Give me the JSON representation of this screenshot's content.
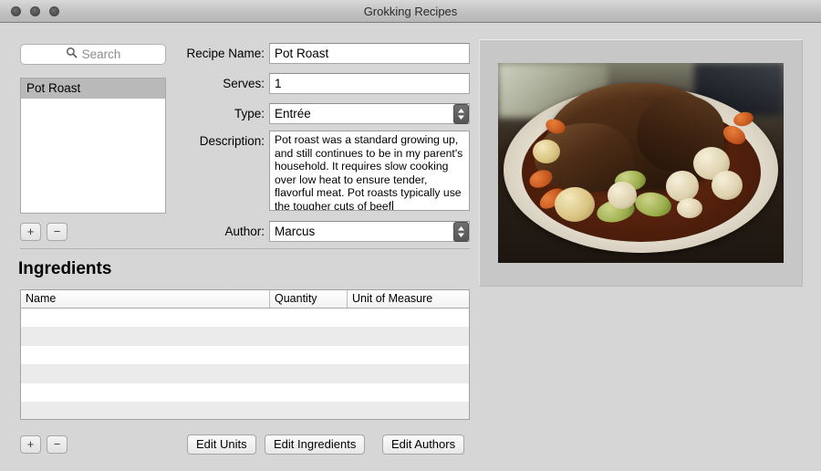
{
  "window": {
    "title": "Grokking Recipes",
    "traffic_lights": [
      "close",
      "minimize",
      "maximize"
    ]
  },
  "sidebar": {
    "search": {
      "placeholder": "Search",
      "value": "",
      "icon": "search-icon"
    },
    "list": {
      "items": [
        {
          "label": "Pot Roast",
          "selected": true
        }
      ]
    },
    "add_label": "+",
    "remove_label": "−"
  },
  "form": {
    "recipe_name": {
      "label": "Recipe Name:",
      "value": "Pot Roast"
    },
    "serves": {
      "label": "Serves:",
      "value": "1"
    },
    "type": {
      "label": "Type:",
      "value": "Entrée"
    },
    "description": {
      "label": "Description:",
      "value": "Pot roast was a standard growing up, and still continues to be in my parent's household.  It requires slow cooking over low heat to ensure tender, flavorful meat. Pot roasts typically use the tougher cuts of beef"
    },
    "author": {
      "label": "Author:",
      "value": "Marcus"
    }
  },
  "ingredients": {
    "title": "Ingredients",
    "columns": [
      "Name",
      "Quantity",
      "Unit of Measure"
    ],
    "rows": [],
    "empty_row_count": 7,
    "add_label": "+",
    "remove_label": "−"
  },
  "buttons": {
    "edit_units": "Edit Units",
    "edit_ingredients": "Edit Ingredients",
    "edit_authors": "Edit Authors"
  },
  "image_well": {
    "alt": "pot-roast-photo"
  },
  "colors": {
    "window_background": "#d6d6d6",
    "titlebar_top": "#d8d8d8",
    "titlebar_bottom": "#b6b6b6",
    "selection": "#b9b9b9",
    "field_background": "#ffffff",
    "image_well_background": "#c7c7c7",
    "stripe": "#ebebeb"
  }
}
